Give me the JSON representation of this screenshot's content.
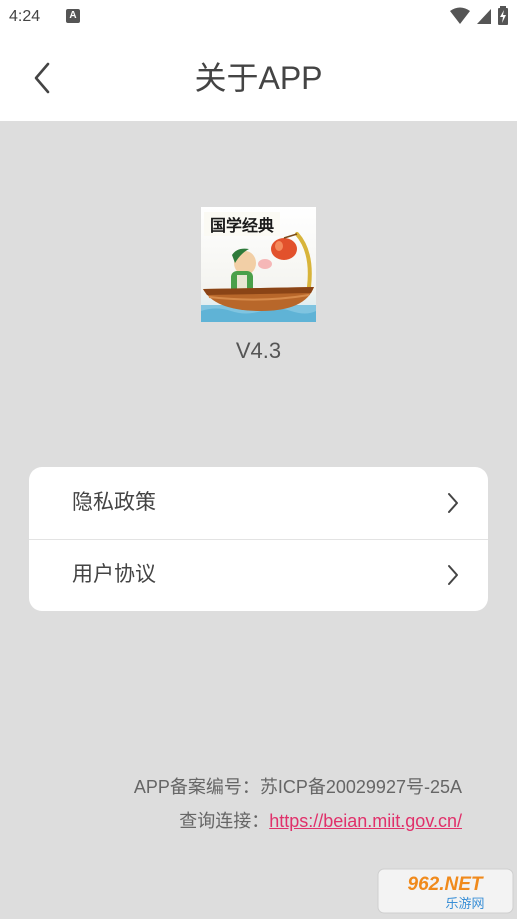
{
  "status_bar": {
    "time": "4:24",
    "notification_glyph": "A",
    "icons": [
      "wifi-icon",
      "signal-icon",
      "battery-charging-icon"
    ]
  },
  "header": {
    "title": "关于APP",
    "back_icon": "back-arrow-icon"
  },
  "app": {
    "icon_title": "国学经典",
    "version": "V4.3"
  },
  "menu": {
    "items": [
      {
        "label": "隐私政策",
        "icon": "chevron-right-icon"
      },
      {
        "label": "用户协议",
        "icon": "chevron-right-icon"
      }
    ]
  },
  "footer": {
    "record_label": "APP备案编号：",
    "record_value": "苏ICP备20029927号-25A",
    "query_label": "查询连接：",
    "query_link": "https://beian.miit.gov.cn/"
  },
  "watermark": {
    "top": "962.NET",
    "bottom": "乐游网"
  },
  "colors": {
    "background": "#dddddd",
    "card": "#ffffff",
    "link": "#e0306a",
    "text": "#444444"
  }
}
